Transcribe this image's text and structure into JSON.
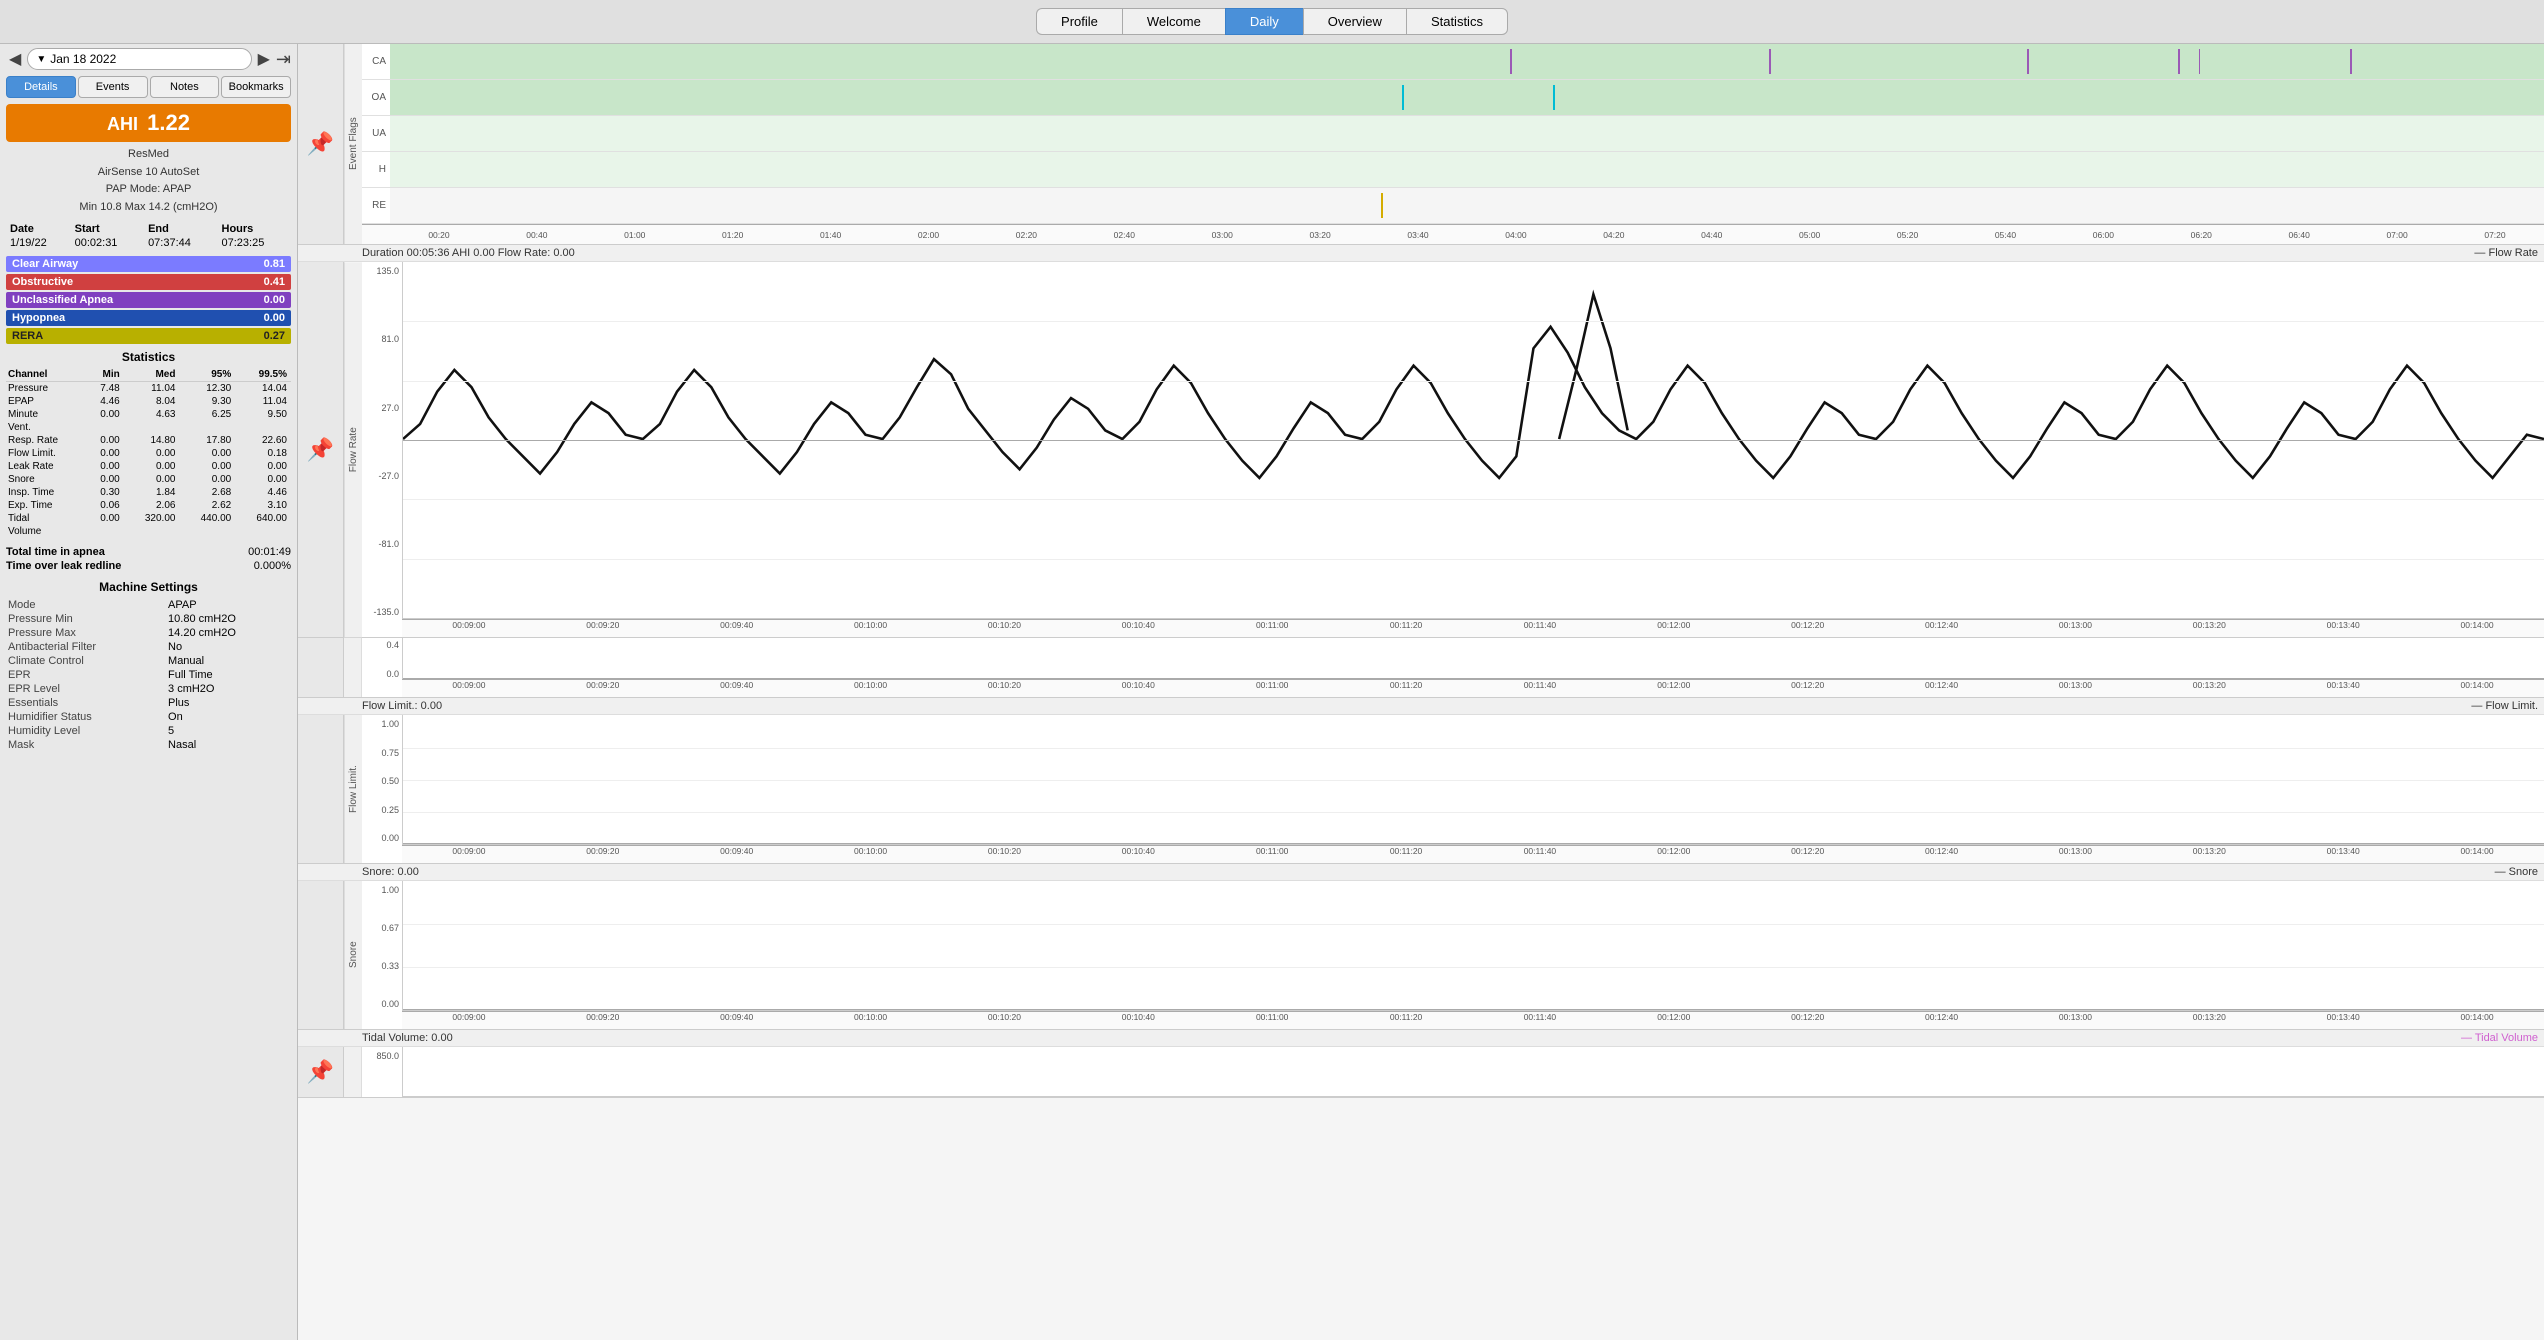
{
  "nav": {
    "tabs": [
      {
        "label": "Profile",
        "active": false
      },
      {
        "label": "Welcome",
        "active": false
      },
      {
        "label": "Daily",
        "active": true
      },
      {
        "label": "Overview",
        "active": false
      },
      {
        "label": "Statistics",
        "active": false
      }
    ]
  },
  "left": {
    "date": "Jan 18 2022",
    "tabs": [
      "Details",
      "Events",
      "Notes",
      "Bookmarks"
    ],
    "active_tab": "Details",
    "ahi": {
      "label": "AHI",
      "value": "1.22"
    },
    "device": {
      "brand": "ResMed",
      "model": "AirSense 10 AutoSet",
      "pap_mode": "PAP Mode: APAP",
      "pressure": "Min 10.8 Max 14.2 (cmH2O)"
    },
    "summary": {
      "date": "1/19/22",
      "start": "00:02:31",
      "end": "07:37:44",
      "hours": "07:23:25"
    },
    "events": [
      {
        "label": "Clear Airway",
        "value": "0.81",
        "class": "ev-clear"
      },
      {
        "label": "Obstructive",
        "value": "0.41",
        "class": "ev-obstr"
      },
      {
        "label": "Unclassified Apnea",
        "value": "0.00",
        "class": "ev-unclass"
      },
      {
        "label": "Hypopnea",
        "value": "0.00",
        "class": "ev-hypo"
      },
      {
        "label": "RERA",
        "value": "0.27",
        "class": "ev-rera"
      }
    ],
    "stats": {
      "header": "Statistics",
      "columns": [
        "Channel",
        "Min",
        "Med",
        "95%",
        "99.5%"
      ],
      "rows": [
        [
          "Pressure",
          "7.48",
          "11.04",
          "12.30",
          "14.04"
        ],
        [
          "EPAP",
          "4.46",
          "8.04",
          "9.30",
          "11.04"
        ],
        [
          "Minute",
          "0.00",
          "4.63",
          "6.25",
          "9.50"
        ],
        [
          "Vent.",
          "",
          "",
          "",
          ""
        ],
        [
          "Resp. Rate",
          "0.00",
          "14.80",
          "17.80",
          "22.60"
        ],
        [
          "Flow Limit.",
          "0.00",
          "0.00",
          "0.00",
          "0.18"
        ],
        [
          "Leak Rate",
          "0.00",
          "0.00",
          "0.00",
          "0.00"
        ],
        [
          "Snore",
          "0.00",
          "0.00",
          "0.00",
          "0.00"
        ],
        [
          "Insp. Time",
          "0.30",
          "1.84",
          "2.68",
          "4.46"
        ],
        [
          "Exp. Time",
          "0.06",
          "2.06",
          "2.62",
          "3.10"
        ],
        [
          "Tidal",
          "0.00",
          "320.00",
          "440.00",
          "640.00"
        ],
        [
          "Volume",
          "",
          "",
          "",
          ""
        ]
      ]
    },
    "totals": {
      "total_time_label": "Total time in apnea",
      "total_time_value": "00:01:49",
      "leak_label": "Time over leak redline",
      "leak_value": "0.000%"
    },
    "machine": {
      "header": "Machine Settings",
      "rows": [
        [
          "Mode",
          "APAP"
        ],
        [
          "Pressure Min",
          "10.80 cmH2O"
        ],
        [
          "Pressure Max",
          "14.20 cmH2O"
        ],
        [
          "Antibacterial Filter",
          "No"
        ],
        [
          "Climate Control",
          "Manual"
        ],
        [
          "EPR",
          "Full Time"
        ],
        [
          "EPR Level",
          "3 cmH2O"
        ],
        [
          "Essentials",
          "Plus"
        ],
        [
          "Humidifier Status",
          "On"
        ],
        [
          "Humidity Level",
          "5"
        ],
        [
          "Mask",
          "Nasal"
        ]
      ]
    }
  },
  "charts": {
    "event_flags": {
      "title": "Event Flags",
      "rows": [
        "CA",
        "OA",
        "UA",
        "H",
        "RE"
      ],
      "time_labels": [
        "00:20",
        "00:40",
        "01:00",
        "01:20",
        "01:40",
        "02:00",
        "02:20",
        "02:40",
        "03:00",
        "03:20",
        "03:40",
        "04:00",
        "04:20",
        "04:40",
        "05:00",
        "05:20",
        "05:40",
        "06:00",
        "06:20",
        "06:40",
        "07:00",
        "07:20"
      ]
    },
    "flow_rate": {
      "title": "Duration 00:05:36 AHI 0.00 Flow Rate: 0.00",
      "legend": "Flow Rate",
      "y_labels": [
        "135.0",
        "81.0",
        "27.0",
        "-27.0",
        "-81.0",
        "-135.0"
      ],
      "time_labels": [
        "00:09:00",
        "00:09:20",
        "00:09:40",
        "00:10:00",
        "00:10:20",
        "00:10:40",
        "00:11:00",
        "00:11:20",
        "00:11:40",
        "00:12:00",
        "00:12:20",
        "00:12:40",
        "00:13:00",
        "00:13:20",
        "00:13:40",
        "00:14:00"
      ]
    },
    "flow_limit": {
      "title": "Flow Limit.: 0.00",
      "legend": "Flow Limit.",
      "y_labels": [
        "1.00",
        "0.75",
        "0.50",
        "0.25",
        "0.00"
      ],
      "time_labels": [
        "00:09:00",
        "00:09:20",
        "00:09:40",
        "00:10:00",
        "00:10:20",
        "00:10:40",
        "00:11:00",
        "00:11:20",
        "00:11:40",
        "00:12:00",
        "00:12:20",
        "00:12:40",
        "00:13:00",
        "00:13:20",
        "00:13:40",
        "00:14:00"
      ]
    },
    "snore": {
      "title": "Snore: 0.00",
      "legend": "Snore",
      "y_labels": [
        "1.00",
        "0.67",
        "0.33",
        "0.00"
      ],
      "time_labels": [
        "00:09:00",
        "00:09:20",
        "00:09:40",
        "00:10:00",
        "00:10:20",
        "00:10:40",
        "00:11:00",
        "00:11:20",
        "00:11:40",
        "00:12:00",
        "00:12:20",
        "00:12:40",
        "00:13:00",
        "00:13:20",
        "00:13:40",
        "00:14:00"
      ]
    },
    "tidal_volume": {
      "title": "Tidal Volume: 0.00",
      "legend": "Tidal Volume",
      "y_labels": [
        "850.0"
      ]
    }
  }
}
